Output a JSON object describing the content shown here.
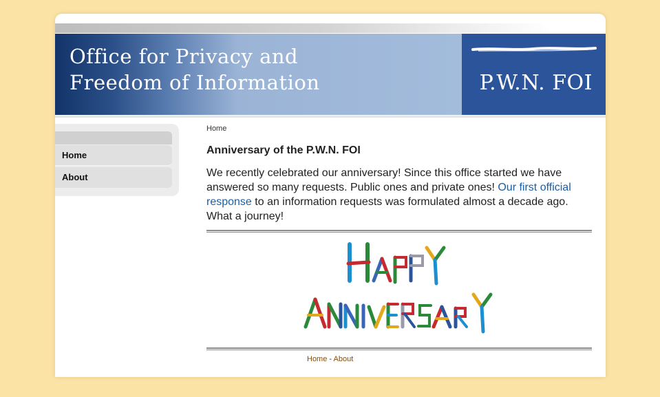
{
  "header": {
    "title_line1": "Office for Privacy and",
    "title_line2": "Freedom of Information",
    "brand": "P.W.N. FOI"
  },
  "sidebar": {
    "items": [
      {
        "label": "Home"
      },
      {
        "label": "About"
      }
    ]
  },
  "breadcrumb": "Home",
  "article": {
    "title": "Anniversary of the P.W.N. FOI",
    "text_before_link": "We recently celebrated our anniversary! Since this office started we have answered so many requests. Public ones and private ones! ",
    "link_text": "Our first official response",
    "text_after_link": " to an information requests was formulated almost a decade ago. What a journey!"
  },
  "image": {
    "line1": "HAPPY",
    "line2": "ANNIVERSARY"
  },
  "footer": {
    "home": "Home",
    "separator": " - ",
    "about": "About"
  },
  "colors": {
    "page_background": "#fbe3a6",
    "banner_dark": "#12346a",
    "brand_box": "#2b549b",
    "link": "#1a5ea6",
    "footer_link": "#8a4a00"
  }
}
